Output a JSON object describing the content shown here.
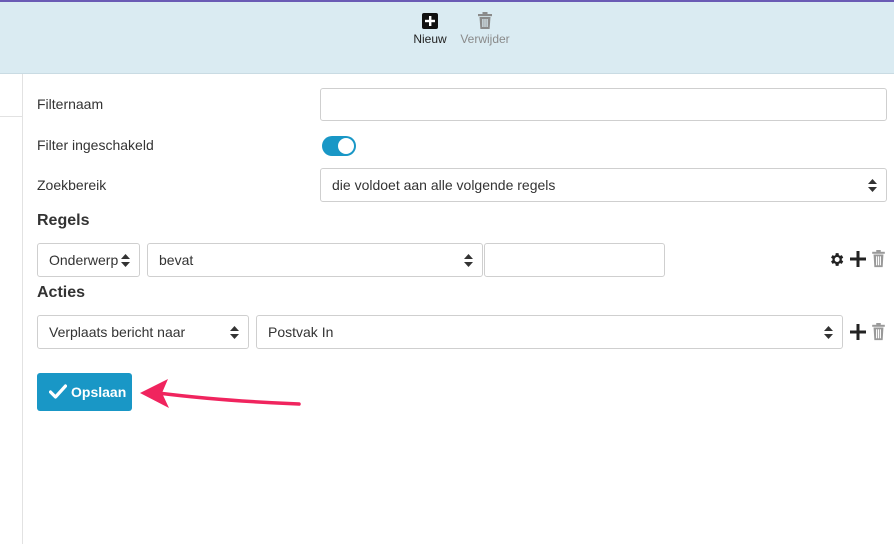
{
  "toolbar": {
    "new_label": "Nieuw",
    "delete_label": "Verwijder"
  },
  "form": {
    "filter_name_label": "Filternaam",
    "filter_name_value": "",
    "filter_enabled_label": "Filter ingeschakeld",
    "filter_enabled": true,
    "scope_label": "Zoekbereik",
    "scope_value": "die voldoet aan alle volgende regels"
  },
  "rules": {
    "heading": "Regels",
    "field_value": "Onderwerp",
    "operator_value": "bevat",
    "value_input": ""
  },
  "actions": {
    "heading": "Acties",
    "action_value": "Verplaats bericht naar",
    "target_value": "Postvak In"
  },
  "save_label": "Opslaan",
  "colors": {
    "accent": "#1997c6",
    "toolbar_bg": "#daebf2",
    "annotation_arrow": "#f0245e"
  },
  "icons": [
    "plus-square-icon",
    "trash-icon",
    "gear-icon",
    "plus-icon",
    "check-icon",
    "sort-arrows-icon"
  ]
}
